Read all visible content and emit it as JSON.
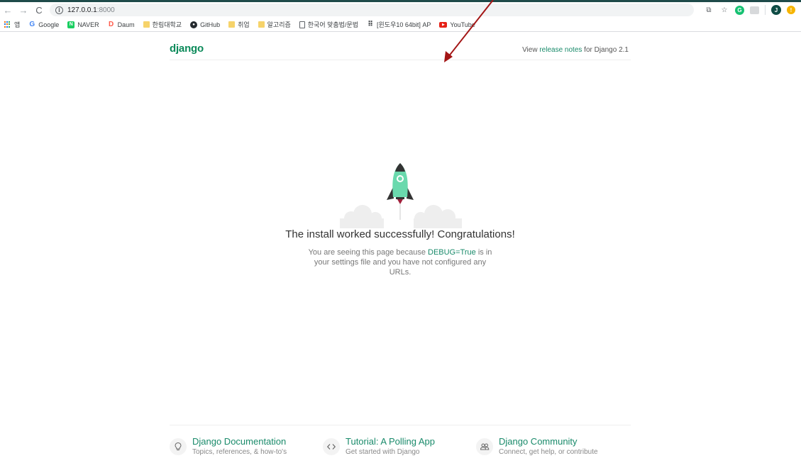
{
  "browser": {
    "url_host": "127.0.0.1",
    "url_port": ":8000",
    "info_glyph": "i",
    "bookmarks": [
      {
        "label": "앱",
        "icon": "apps-icon"
      },
      {
        "label": "Google",
        "icon": "google-icon"
      },
      {
        "label": "NAVER",
        "icon": "naver-icon"
      },
      {
        "label": "Daum",
        "icon": "daum-icon"
      },
      {
        "label": "한림대학교",
        "icon": "folder-icon"
      },
      {
        "label": "GitHub",
        "icon": "github-icon"
      },
      {
        "label": "취업",
        "icon": "folder-icon"
      },
      {
        "label": "알고리즘",
        "icon": "folder-icon"
      },
      {
        "label": "한국어 맞춤법/문법",
        "icon": "page-icon"
      },
      {
        "label": "[윈도우10 64bit] AP",
        "icon": "t-icon"
      },
      {
        "label": "YouTube",
        "icon": "youtube-icon"
      }
    ],
    "icon_glyphs": {
      "back": "←",
      "forward": "→",
      "reload": "C",
      "translate": "⧉",
      "star": "☆",
      "grammarly": "G",
      "avatar": "J",
      "alert": "!",
      "google": "G",
      "naver": "N",
      "daum": "D",
      "github": "●",
      "t": "⠿",
      "youtube": "▶"
    },
    "colors": {
      "top_accent": "#1f4b4a",
      "grammarly": "#16c172",
      "avatar": "#0f4c45",
      "alert": "#f6b400"
    }
  },
  "page": {
    "logo": "django",
    "release": {
      "prefix": "View ",
      "link": "release notes",
      "suffix": " for Django 2.1"
    },
    "title": "The install worked successfully! Congratulations!",
    "desc": {
      "part1": "You are seeing this page because ",
      "debug": "DEBUG=True",
      "part2": " is in your settings file and you have not configured any URLs."
    },
    "footer": [
      {
        "title": "Django Documentation",
        "sub": "Topics, references, & how-to's",
        "icon": "lightbulb-icon"
      },
      {
        "title": "Tutorial: A Polling App",
        "sub": "Get started with Django",
        "icon": "code-icon"
      },
      {
        "title": "Django Community",
        "sub": "Connect, get help, or contribute",
        "icon": "people-icon"
      }
    ],
    "colors": {
      "brand": "#0c8a5a",
      "link": "#198a6a",
      "rocket_body": "#6ad9ad",
      "annotation_arrow": "#a31515"
    }
  }
}
